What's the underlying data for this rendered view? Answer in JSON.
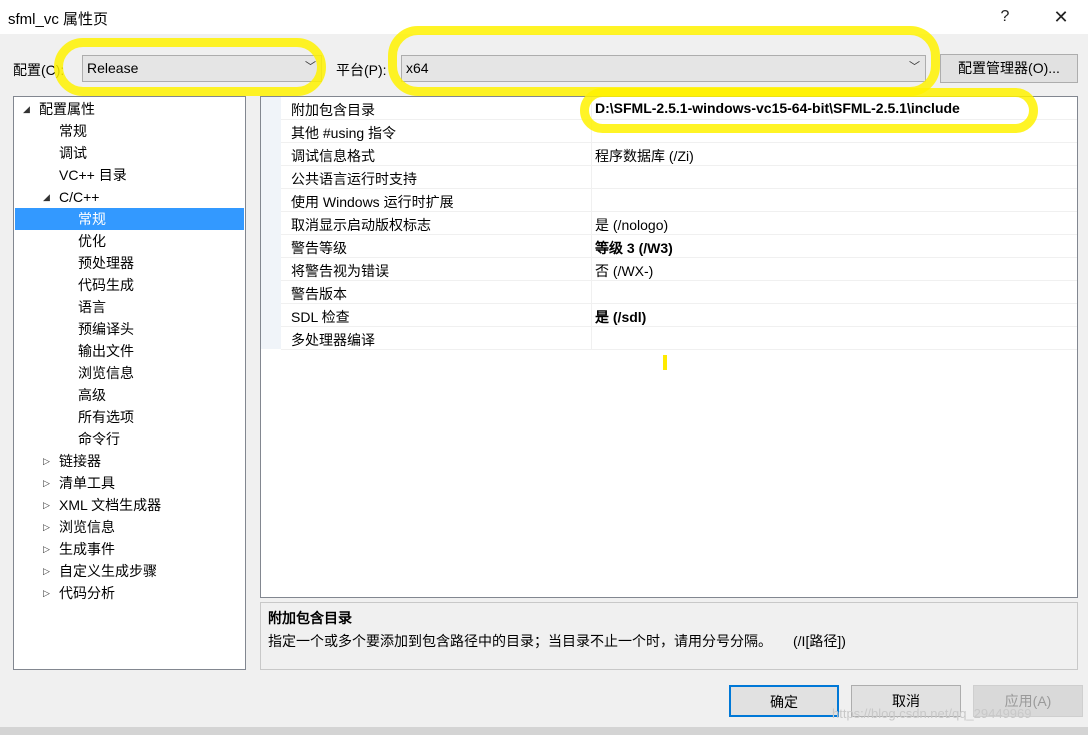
{
  "window": {
    "title": "sfml_vc 属性页",
    "help": "?",
    "close": "✕"
  },
  "config": {
    "config_label": "配置(C):",
    "config_value": "Release",
    "platform_label": "平台(P):",
    "platform_value": "x64",
    "manager_button": "配置管理器(O)...",
    "arrow": "﹀"
  },
  "tree": {
    "items": [
      {
        "label": "配置属性",
        "toggle": "◢"
      },
      {
        "label": "常规"
      },
      {
        "label": "调试"
      },
      {
        "label": "VC++ 目录"
      },
      {
        "label": "C/C++",
        "toggle": "◢"
      },
      {
        "label": "常规"
      },
      {
        "label": "优化"
      },
      {
        "label": "预处理器"
      },
      {
        "label": "代码生成"
      },
      {
        "label": "语言"
      },
      {
        "label": "预编译头"
      },
      {
        "label": "输出文件"
      },
      {
        "label": "浏览信息"
      },
      {
        "label": "高级"
      },
      {
        "label": "所有选项"
      },
      {
        "label": "命令行"
      },
      {
        "label": "链接器",
        "toggle": "▷"
      },
      {
        "label": "清单工具",
        "toggle": "▷"
      },
      {
        "label": "XML 文档生成器",
        "toggle": "▷"
      },
      {
        "label": "浏览信息",
        "toggle": "▷"
      },
      {
        "label": "生成事件",
        "toggle": "▷"
      },
      {
        "label": "自定义生成步骤",
        "toggle": "▷"
      },
      {
        "label": "代码分析",
        "toggle": "▷"
      }
    ]
  },
  "properties": [
    {
      "name": "附加包含目录",
      "value": "D:\\SFML-2.5.1-windows-vc15-64-bit\\SFML-2.5.1\\include"
    },
    {
      "name": "其他 #using 指令",
      "value": ""
    },
    {
      "name": "调试信息格式",
      "value": "程序数据库 (/Zi)"
    },
    {
      "name": "公共语言运行时支持",
      "value": ""
    },
    {
      "name": "使用 Windows 运行时扩展",
      "value": ""
    },
    {
      "name": "取消显示启动版权标志",
      "value": "是 (/nologo)"
    },
    {
      "name": "警告等级",
      "value": "等级 3 (/W3)"
    },
    {
      "name": "将警告视为错误",
      "value": "否 (/WX-)"
    },
    {
      "name": "警告版本",
      "value": ""
    },
    {
      "name": "SDL 检查",
      "value": "是 (/sdl)"
    },
    {
      "name": "多处理器编译",
      "value": ""
    }
  ],
  "description": {
    "title": "附加包含目录",
    "text": "指定一个或多个要添加到包含路径中的目录；当目录不止一个时，请用分号分隔。　　(/I[路径])"
  },
  "buttons": {
    "ok": "确定",
    "cancel": "取消",
    "apply": "应用(A)"
  },
  "watermark": "https://blog.csdn.net/qq_29449969",
  "colors": {
    "selection": "#3399ff",
    "highlight": "#fff200",
    "accent": "#0078d7"
  }
}
